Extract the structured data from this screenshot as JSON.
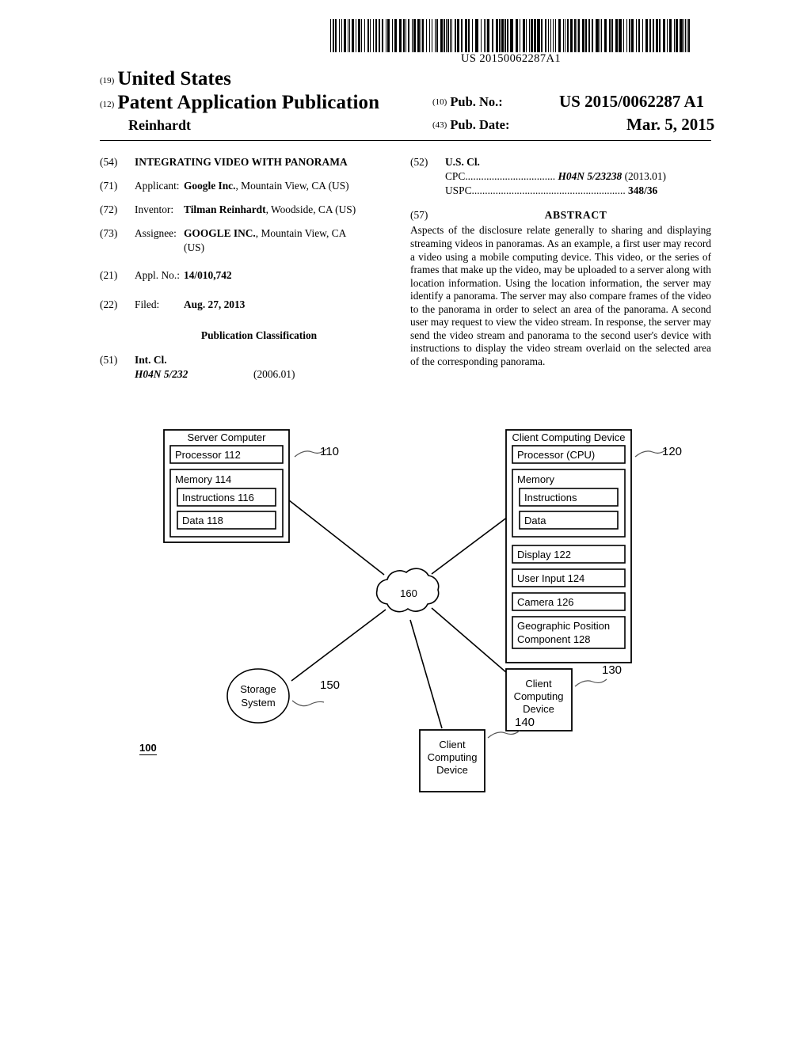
{
  "header": {
    "barcode_number": "US 20150062287A1",
    "code_19": "(19)",
    "country": "United States",
    "code_12": "(12)",
    "doc_type": "Patent Application Publication",
    "inventor_surname": "Reinhardt",
    "code_10": "(10)",
    "pub_no_label": "Pub. No.:",
    "pub_no_value": "US 2015/0062287 A1",
    "code_43": "(43)",
    "pub_date_label": "Pub. Date:",
    "pub_date_value": "Mar. 5, 2015"
  },
  "left_column": {
    "title_code": "(54)",
    "title": "INTEGRATING VIDEO WITH PANORAMA",
    "applicant_code": "(71)",
    "applicant_label": "Applicant:",
    "applicant_name": "Google Inc.",
    "applicant_rest": ", Mountain View, CA (US)",
    "inventor_code": "(72)",
    "inventor_label": "Inventor:",
    "inventor_name": "Tilman Reinhardt",
    "inventor_rest": ", Woodside, CA (US)",
    "assignee_code": "(73)",
    "assignee_label": "Assignee:",
    "assignee_name": "GOOGLE INC.",
    "assignee_rest": ", Mountain View, CA",
    "assignee_rest2": "(US)",
    "appl_no_code": "(21)",
    "appl_no_label": "Appl. No.:",
    "appl_no_value": "14/010,742",
    "filed_code": "(22)",
    "filed_label": "Filed:",
    "filed_value": "Aug. 27, 2013",
    "pub_class_heading": "Publication Classification",
    "int_cl_code": "(51)",
    "int_cl_label": "Int. Cl.",
    "int_cl_value": "H04N 5/232",
    "int_cl_version": "(2006.01)"
  },
  "right_column": {
    "us_cl_code": "(52)",
    "us_cl_label": "U.S. Cl.",
    "cpc_key": "CPC",
    "cpc_dots": "..................................",
    "cpc_value": "H04N 5/23238",
    "cpc_version": "(2013.01)",
    "uspc_key": "USPC",
    "uspc_dots": "..........................................................",
    "uspc_value": "348/36",
    "abstract_code": "(57)",
    "abstract_title": "ABSTRACT",
    "abstract_text": "Aspects of the disclosure relate generally to sharing and displaying streaming videos in panoramas. As an example, a first user may record a video using a mobile computing device. This video, or the series of frames that make up the video, may be uploaded to a server along with location information. Using the location information, the server may identify a panorama. The server may also compare frames of the video to the panorama in order to select an area of the panorama. A second user may request to view the video stream. In response, the server may send the video stream and panorama to the second user's device with instructions to display the video stream overlaid on the selected area of the corresponding panorama."
  },
  "figure": {
    "figure_number": "100",
    "server": {
      "title": "Server Computer",
      "ref": "110",
      "processor": "Processor 112",
      "memory": "Memory 114",
      "instructions": "Instructions 116",
      "data": "Data 118"
    },
    "client_detail": {
      "title": "Client Computing Device",
      "ref": "120",
      "processor": "Processor (CPU)",
      "memory": "Memory",
      "instructions": "Instructions",
      "data": "Data",
      "display": "Display 122",
      "user_input": "User Input 124",
      "camera": "Camera 126",
      "geo_line1": "Geographic Position",
      "geo_line2": "Component 128"
    },
    "network": {
      "ref": "160"
    },
    "storage": {
      "line1": "Storage",
      "line2": "System",
      "ref": "150"
    },
    "client_130": {
      "line1": "Client",
      "line2": "Computing",
      "line3": "Device",
      "ref": "130"
    },
    "client_140": {
      "line1": "Client",
      "line2": "Computing",
      "line3": "Device",
      "ref": "140"
    }
  },
  "colors": {
    "ink": "#000000",
    "paper": "#ffffff"
  }
}
